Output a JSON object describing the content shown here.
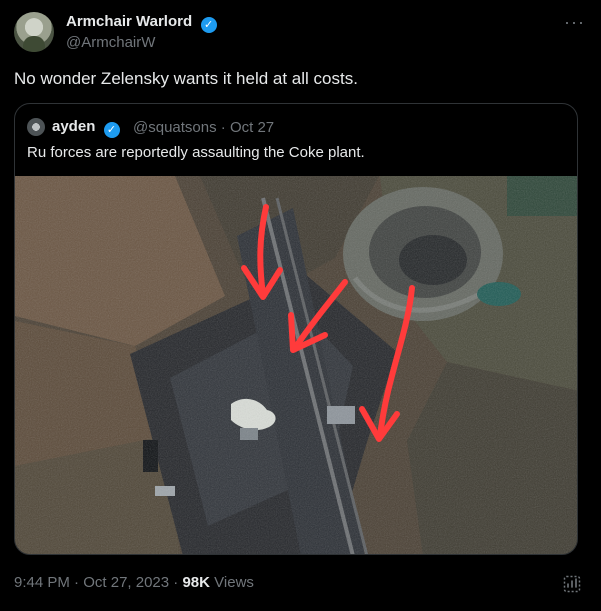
{
  "author": {
    "display_name": "Armchair Warlord",
    "handle": "@ArmchairW",
    "more_label": "···"
  },
  "post": {
    "text": "No wonder Zelensky wants it held at all costs.",
    "time": "9:44 PM",
    "date": "Oct 27, 2023",
    "views_count": "98K",
    "views_label": "Views"
  },
  "quote": {
    "display_name": "ayden",
    "handle": "@squatsons",
    "date": "Oct 27",
    "text": "Ru forces are reportedly assaulting the Coke plant."
  },
  "icons": {
    "verified": "verified-badge-icon",
    "more": "more-options-icon",
    "analytics": "analytics-icon"
  },
  "colors": {
    "accent": "#1d9bf0",
    "text": "#e7e9ea",
    "muted": "#71767b",
    "border": "#2f3336",
    "arrow": "#ff3b3b"
  }
}
